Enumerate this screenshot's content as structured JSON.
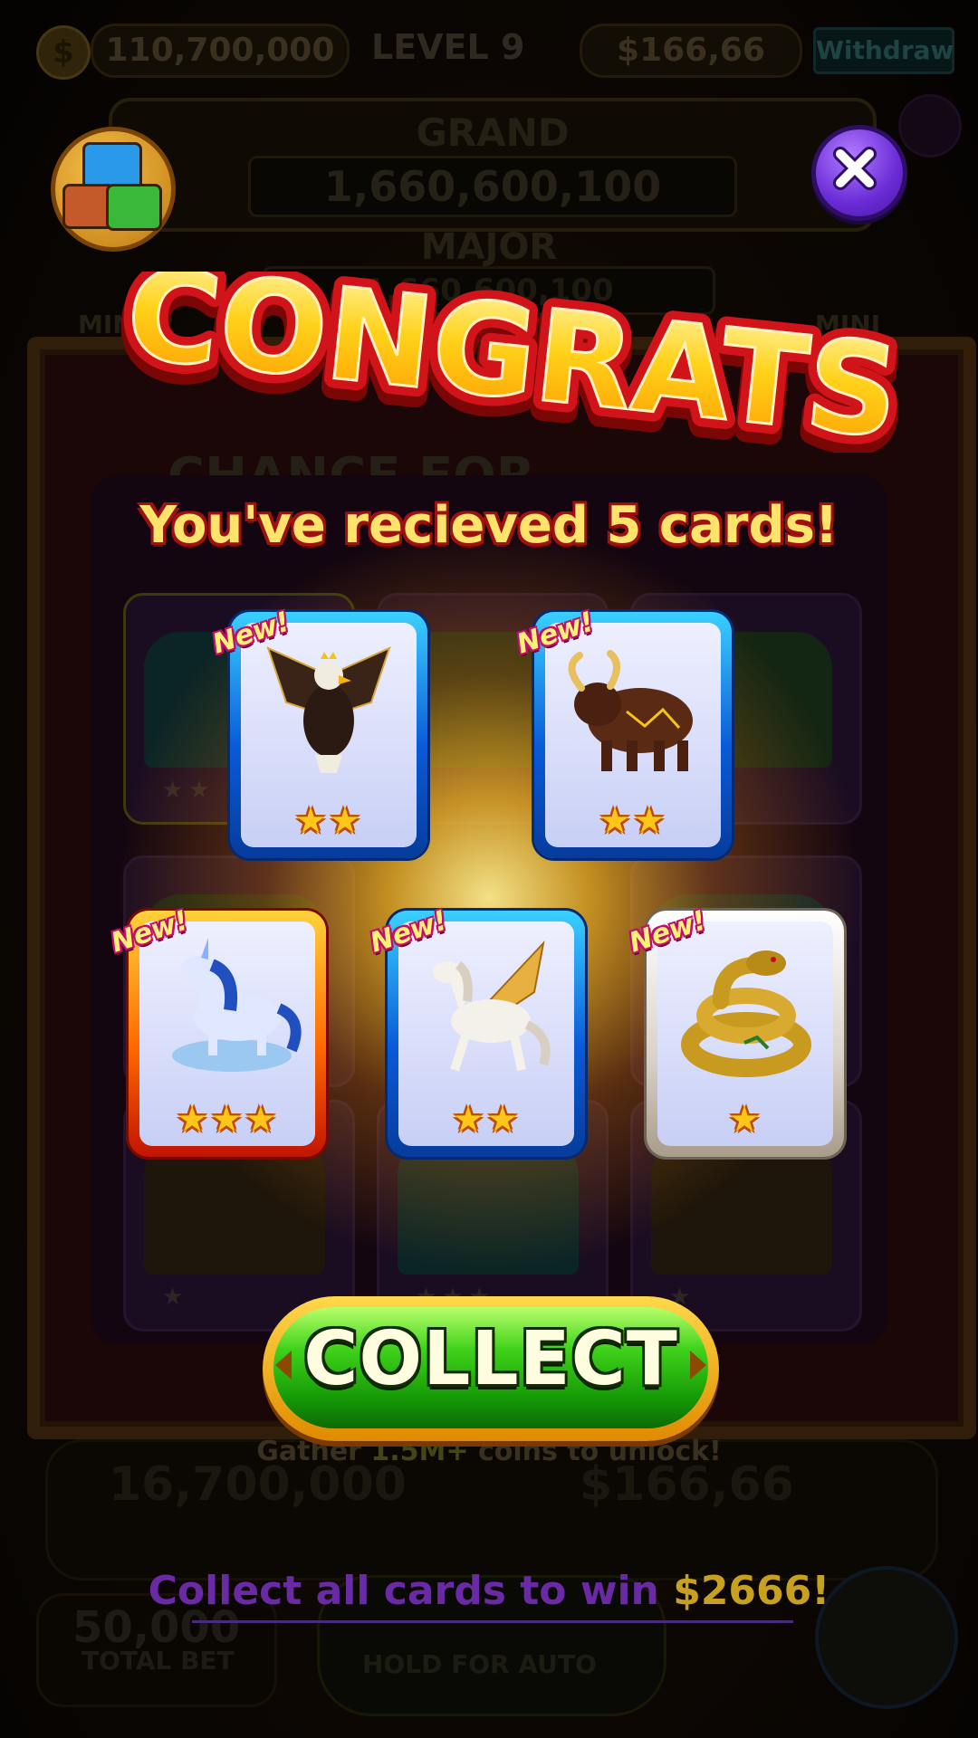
{
  "top_bar": {
    "coins": "110,700,000",
    "level": "LEVEL 9",
    "cash": "$166,66",
    "withdraw_label": "Withdraw"
  },
  "jackpots": {
    "grand_label": "GRAND",
    "grand_value": "1,660,600,100",
    "major_label": "MAJOR",
    "major_value": "1,660,600,100",
    "minor_label": "MINOR",
    "mini_label": "MINI"
  },
  "background": {
    "chance_text": "CHANCE FOR",
    "gather_prefix": "Gather ",
    "gather_amount": "1.5M+",
    "gather_suffix": " coins to unlock!",
    "coins_total": "16,700,000",
    "cash_total": "$166,66",
    "total_bet_value": "50,000",
    "total_bet_label": "TOTAL BET",
    "hold_label": "HOLD FOR AUTO"
  },
  "popup": {
    "title": "CONGRATS",
    "subtitle": "You've recieved 5 cards!",
    "collect_label": "COLLECT",
    "collect_all_prefix": "Collect all cards to win ",
    "collect_all_prize": "$2666!",
    "cards": [
      {
        "animal": "eagle",
        "stars": 2,
        "stars_text": "★★",
        "frame": "blue",
        "tag": "New!"
      },
      {
        "animal": "bull",
        "stars": 2,
        "stars_text": "★★",
        "frame": "blue",
        "tag": "New!"
      },
      {
        "animal": "unicorn",
        "stars": 3,
        "stars_text": "★★★",
        "frame": "orange",
        "tag": "New!"
      },
      {
        "animal": "pegasus",
        "stars": 2,
        "stars_text": "★★",
        "frame": "blue",
        "tag": "New!"
      },
      {
        "animal": "snake",
        "stars": 1,
        "stars_text": "★",
        "frame": "white",
        "tag": "New!"
      }
    ]
  },
  "icons": {
    "chests": "treasure-chests-icon",
    "close": "close-icon"
  },
  "colors": {
    "collect_green": "#3fd21a",
    "close_purple": "#6a2bd6",
    "title_yellow": "#ffe36a",
    "title_red": "#d0141a"
  }
}
